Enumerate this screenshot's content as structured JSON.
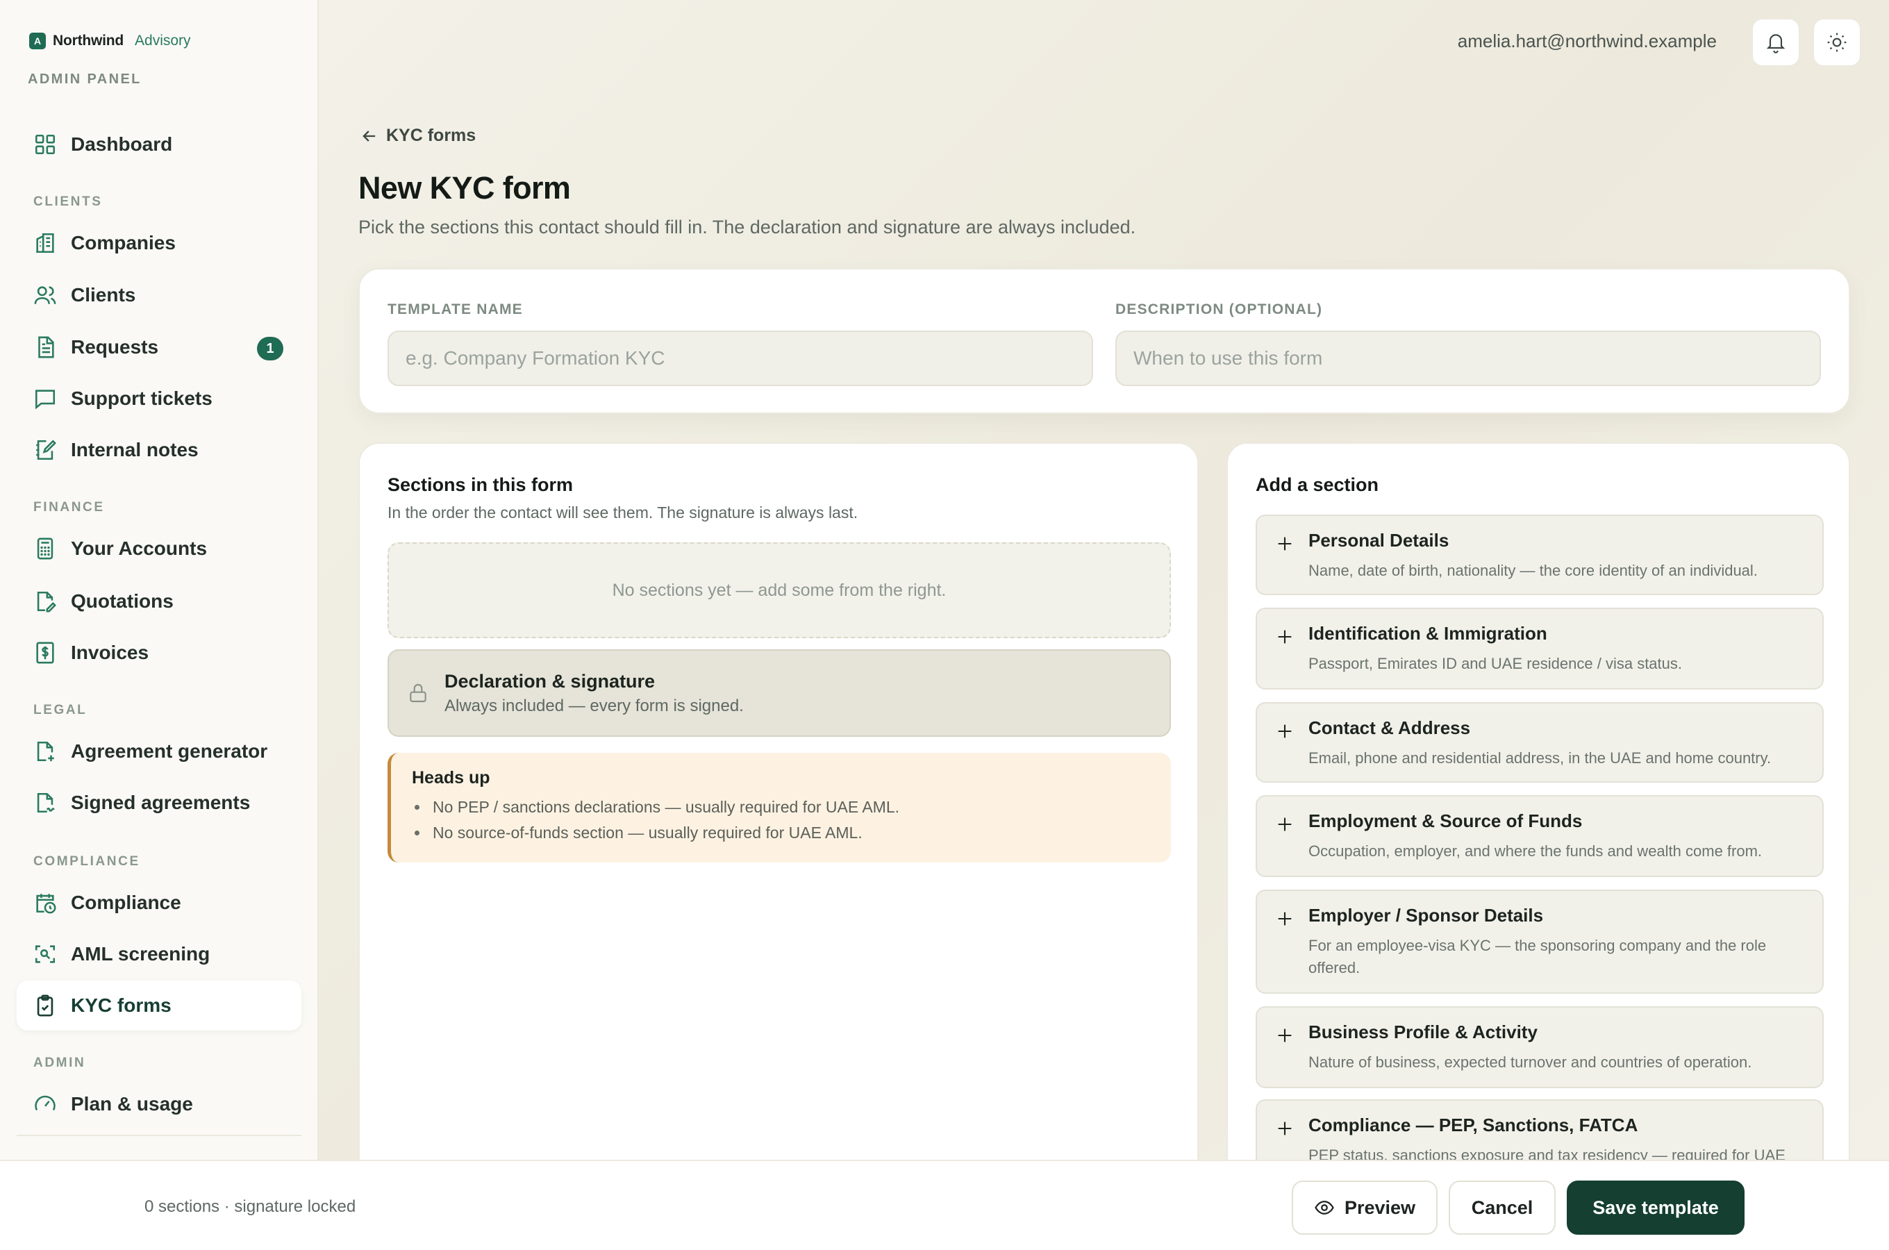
{
  "brand": {
    "mark": "A",
    "name": "Northwind",
    "sub": "Advisory",
    "panel_label": "ADMIN PANEL"
  },
  "sidebar": {
    "dashboard": "Dashboard",
    "groups": {
      "clients": "CLIENTS",
      "finance": "FINANCE",
      "legal": "LEGAL",
      "compliance": "COMPLIANCE",
      "admin": "ADMIN"
    },
    "items": {
      "companies": "Companies",
      "clients": "Clients",
      "requests": "Requests",
      "requests_badge": "1",
      "support": "Support tickets",
      "notes": "Internal notes",
      "accounts": "Your Accounts",
      "quotations": "Quotations",
      "invoices": "Invoices",
      "agreement_gen": "Agreement generator",
      "signed": "Signed agreements",
      "compliance": "Compliance",
      "aml": "AML screening",
      "kyc": "KYC forms",
      "plan": "Plan & usage"
    }
  },
  "topbar": {
    "email": "amelia.hart@northwind.example",
    "icons": [
      "bell-icon",
      "sun-icon"
    ]
  },
  "page": {
    "back_label": "KYC forms",
    "title": "New KYC form",
    "subtitle": "Pick the sections this contact should fill in. The declaration and signature are always included."
  },
  "meta_form": {
    "name_label": "TEMPLATE NAME",
    "name_value": "",
    "name_placeholder": "e.g. Company Formation KYC",
    "desc_label": "DESCRIPTION (OPTIONAL)",
    "desc_value": "",
    "desc_placeholder": "When to use this form"
  },
  "sections_panel": {
    "title": "Sections in this form",
    "subtitle": "In the order the contact will see them. The signature is always last.",
    "empty": "No sections yet — add some from the right.",
    "declaration_title": "Declaration & signature",
    "declaration_sub": "Always included — every form is signed.",
    "headsup_title": "Heads up",
    "headsup_items": [
      "No PEP / sanctions declarations — usually required for UAE AML.",
      "No source-of-funds section — usually required for UAE AML."
    ]
  },
  "add_panel": {
    "title": "Add a section",
    "items": [
      {
        "name": "Personal Details",
        "desc": "Name, date of birth, nationality — the core identity of an individual."
      },
      {
        "name": "Identification & Immigration",
        "desc": "Passport, Emirates ID and UAE residence / visa status."
      },
      {
        "name": "Contact & Address",
        "desc": "Email, phone and residential address, in the UAE and home country."
      },
      {
        "name": "Employment & Source of Funds",
        "desc": "Occupation, employer, and where the funds and wealth come from."
      },
      {
        "name": "Employer / Sponsor Details",
        "desc": "For an employee-visa KYC — the sponsoring company and the role offered."
      },
      {
        "name": "Business Profile & Activity",
        "desc": "Nature of business, expected turnover and countries of operation."
      },
      {
        "name": "Compliance — PEP, Sanctions, FATCA",
        "desc": "PEP status, sanctions exposure and tax residency — required for UAE"
      }
    ]
  },
  "footer": {
    "status": "0 sections · signature locked",
    "preview": "Preview",
    "cancel": "Cancel",
    "save": "Save template"
  },
  "colors": {
    "accent": "#1f6b54",
    "primary_button": "#143f31",
    "warning_border": "#c48a3c",
    "warning_bg": "#fdf2e2"
  }
}
